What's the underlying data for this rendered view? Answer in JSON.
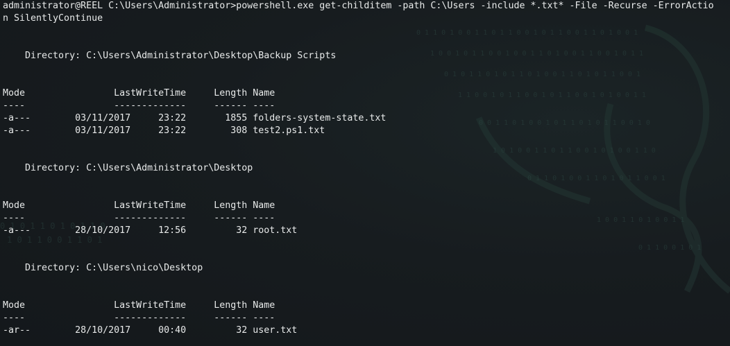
{
  "colors": {
    "background": "#15191c",
    "foreground": "#e8eaea",
    "wallpaper_accent": "#2a3f3c"
  },
  "lines": [
    "administrator@REEL C:\\Users\\Administrator>powershell.exe get-childitem -path C:\\Users -include *.txt* -File -Recurse -ErrorActio",
    "n SilentlyContinue",
    "",
    "",
    "    Directory: C:\\Users\\Administrator\\Desktop\\Backup Scripts",
    "",
    "",
    "Mode                LastWriteTime     Length Name",
    "----                -------------     ------ ----",
    "-a---        03/11/2017     23:22       1855 folders-system-state.txt",
    "-a---        03/11/2017     23:22        308 test2.ps1.txt",
    "",
    "",
    "    Directory: C:\\Users\\Administrator\\Desktop",
    "",
    "",
    "Mode                LastWriteTime     Length Name",
    "----                -------------     ------ ----",
    "-a---        28/10/2017     12:56         32 root.txt",
    "",
    "",
    "    Directory: C:\\Users\\nico\\Desktop",
    "",
    "",
    "Mode                LastWriteTime     Length Name",
    "----                -------------     ------ ----",
    "-ar--        28/10/2017     00:40         32 user.txt"
  ]
}
